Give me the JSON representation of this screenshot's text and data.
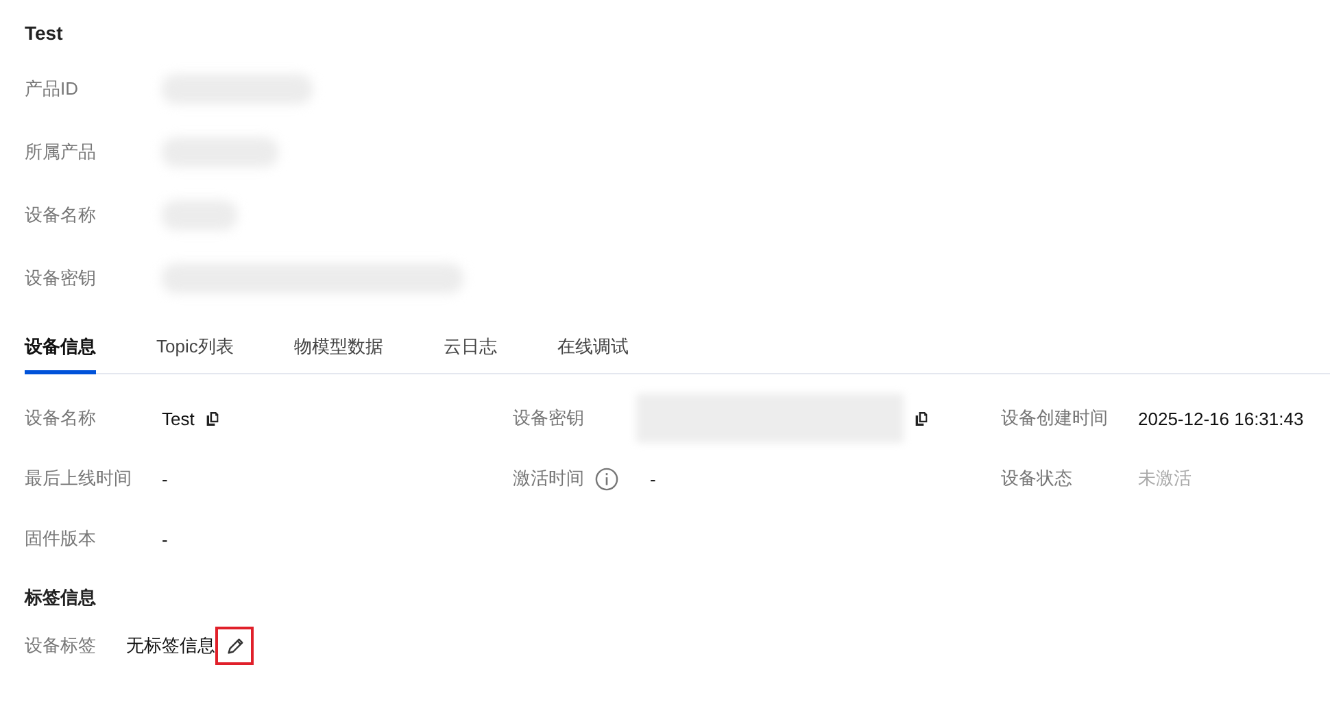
{
  "title": "Test",
  "summary": [
    {
      "label": "产品ID",
      "redacted": true
    },
    {
      "label": "所属产品",
      "redacted": true
    },
    {
      "label": "设备名称",
      "redacted": true
    },
    {
      "label": "设备密钥",
      "redacted": true
    }
  ],
  "tabs": [
    {
      "label": "设备信息",
      "selected": true
    },
    {
      "label": "Topic列表",
      "selected": false
    },
    {
      "label": "物模型数据",
      "selected": false
    },
    {
      "label": "云日志",
      "selected": false
    },
    {
      "label": "在线调试",
      "selected": false
    }
  ],
  "fields": [
    {
      "label": "设备名称",
      "value": "Test",
      "copyable": true
    },
    {
      "label": "设备密钥",
      "redacted": true,
      "copyable": true
    },
    {
      "label": "设备创建时间",
      "value": "2025-12-16 16:31:43"
    },
    {
      "label": "最后上线时间",
      "value": "-"
    },
    {
      "label": "激活时间",
      "value": "-",
      "info_icon": true
    },
    {
      "label": "设备状态",
      "value": "未激活",
      "muted": true
    },
    {
      "label": "固件版本",
      "value": "-"
    }
  ],
  "tag_section": {
    "title": "标签信息",
    "label": "设备标签",
    "value": "无标签信息",
    "edit_highlighted": true
  }
}
